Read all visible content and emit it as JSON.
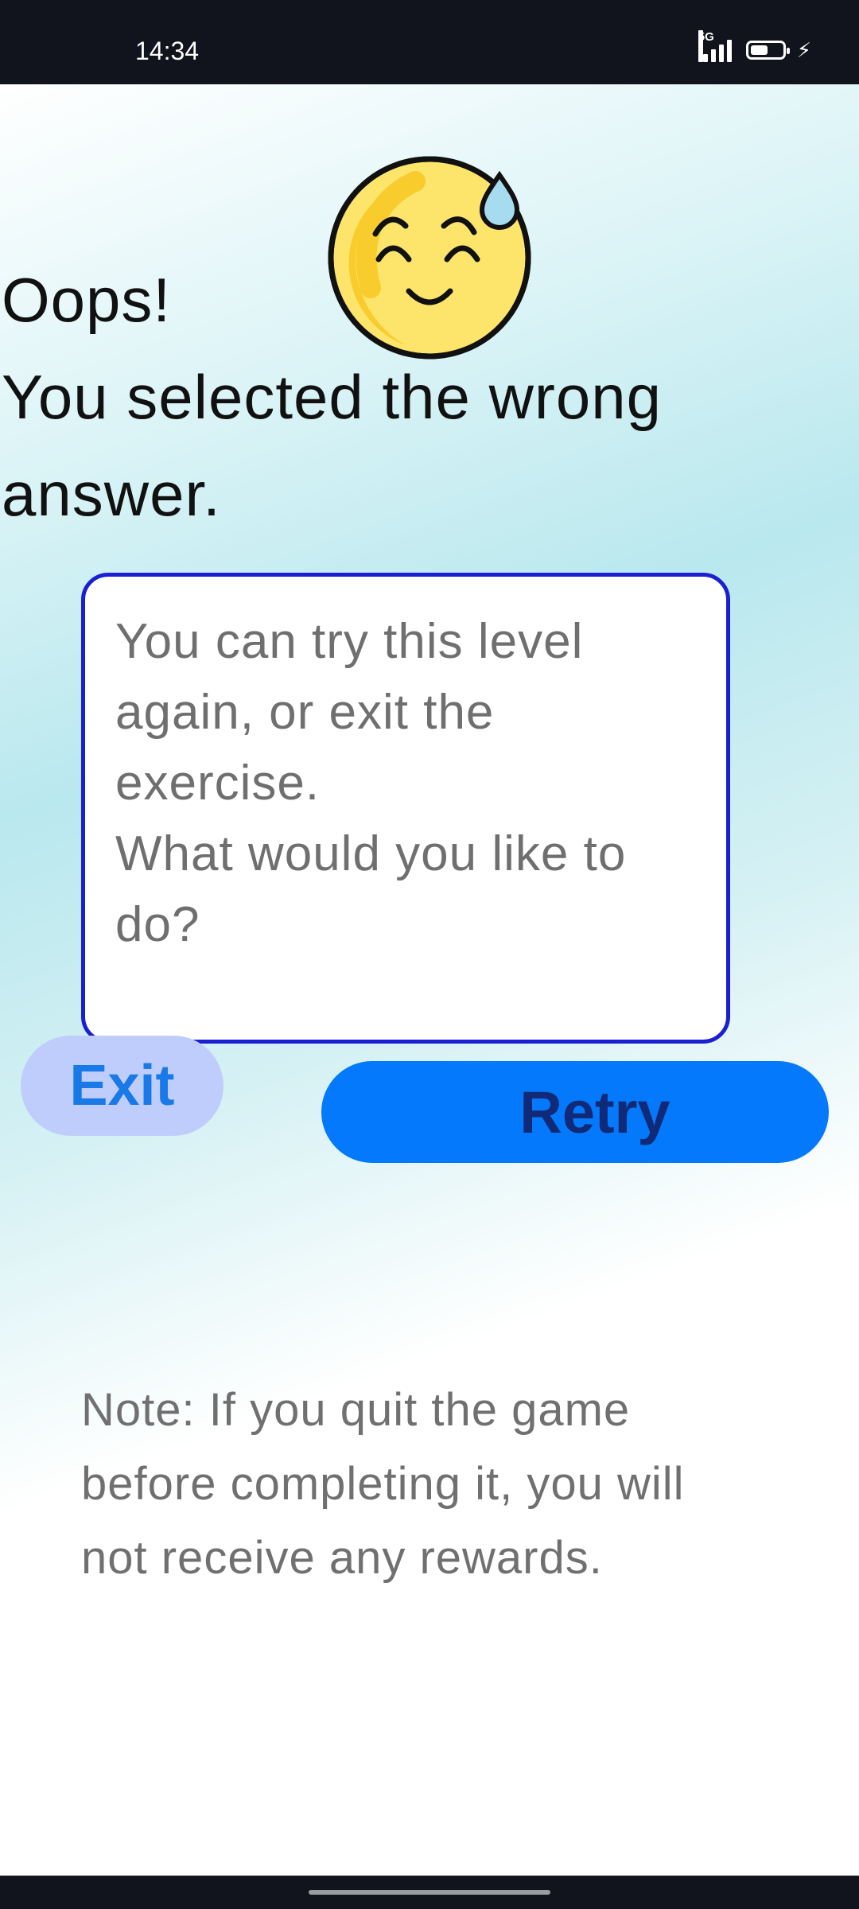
{
  "status_bar": {
    "time": "14:34",
    "network": "5G",
    "battery_level": 0.55,
    "charging": true
  },
  "headline": {
    "line1": "Oops!",
    "line2": "You selected the wrong",
    "line3": "answer."
  },
  "emoji_icon": "sweat-smile-emoji",
  "message": {
    "line1": "You can try this level",
    "line2": "again, or exit the",
    "line3": "exercise.",
    "line4": "What would you like to",
    "line5": "do?"
  },
  "buttons": {
    "exit_label": "Exit",
    "retry_label": "Retry"
  },
  "note": {
    "line1": "Note: If you quit the game",
    "line2": "before completing it, you will",
    "line3": "not receive any rewards."
  },
  "colors": {
    "message_border": "#1a1fd4",
    "retry_bg": "#0479fc",
    "retry_text": "#102a78",
    "exit_bg": "#bfcdfc",
    "exit_text": "#1979e6"
  }
}
